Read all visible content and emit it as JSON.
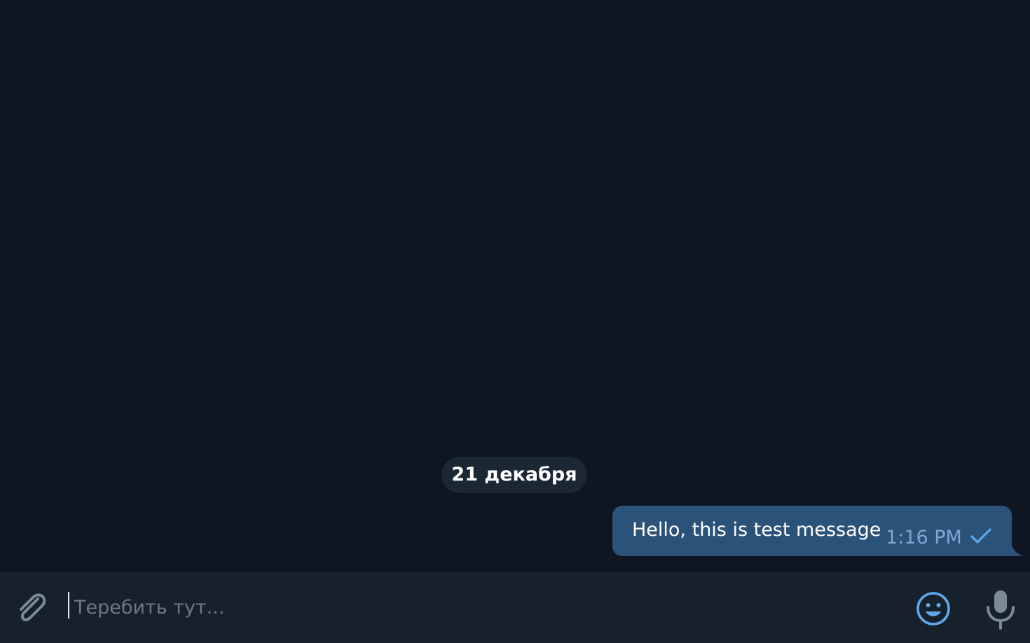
{
  "chat": {
    "date_separator": "21 декабря",
    "messages": [
      {
        "text": "Hello, this is test message",
        "time": "1:16 PM",
        "status_icon": "single-check-icon",
        "outgoing": true
      }
    ]
  },
  "composer": {
    "placeholder": "Теребить тут...",
    "value": "",
    "attach_icon": "paperclip-icon",
    "emoji_icon": "smiley-icon",
    "voice_icon": "microphone-icon"
  },
  "colors": {
    "background": "#0f1622",
    "bubble_outgoing": "#2b5278",
    "date_pill": "#1c2734",
    "composer": "#17212b",
    "accent": "#5fa8e8",
    "icon_gray": "#7d8a96"
  }
}
